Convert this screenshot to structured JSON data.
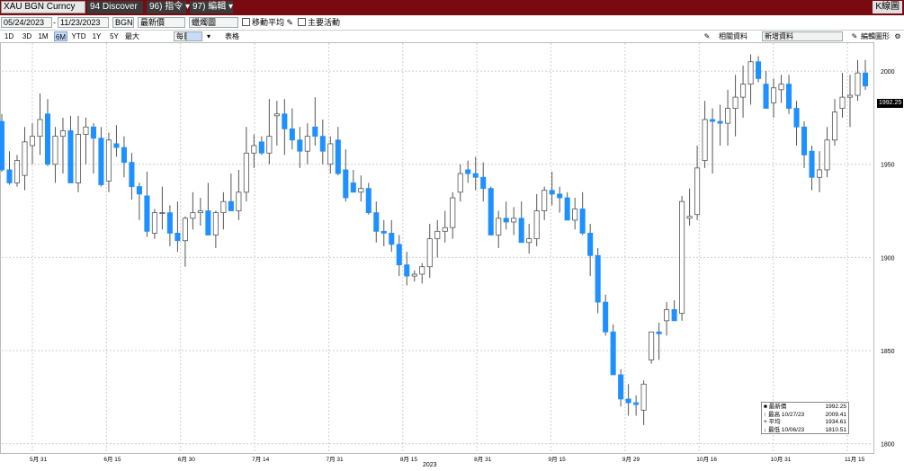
{
  "toolbar": {
    "ticker": "XAU BGN Curncy",
    "discover": "94 Discover",
    "menu_actions": "96) 指令 ▾",
    "menu_edit": "97) 編輯 ▾",
    "right_label": "K線圖"
  },
  "controls": {
    "start_date": "05/24/2023",
    "end_date": "11/23/2023",
    "source": "BGN",
    "field_last": "最新價",
    "chart_type": "蠟燭圖",
    "moving_avg": "移動平均",
    "key_events": "主要活動"
  },
  "periods": [
    "1D",
    "3D",
    "1M",
    "6M",
    "YTD",
    "1Y",
    "5Y",
    "最大"
  ],
  "selected_period": "6M",
  "frequency": "每日 ▼",
  "table_label": "表格",
  "right_controls": {
    "related": "相關資料",
    "news": "新增資料",
    "edit_chart": "編輯圖形"
  },
  "chart_data": {
    "type": "candlestick",
    "y_ticks": [
      1800,
      1850,
      1900,
      1950,
      2000
    ],
    "ylim": [
      1795,
      2015
    ],
    "x_tick_labels": [
      "5月 31",
      "6月 15",
      "6月 30",
      "7月 14",
      "7月 31",
      "8月 15",
      "8月 31",
      "9月 15",
      "9月 29",
      "10月 16",
      "10月 31",
      "11月 15"
    ],
    "year_label": "2023",
    "last_price_label": "1992.25",
    "legend": [
      {
        "key": "最新價",
        "date": "",
        "value": "1992.25"
      },
      {
        "key": "最高",
        "date": "10/27/23",
        "value": "2009.41"
      },
      {
        "key": "平均",
        "date": "",
        "value": "1934.61"
      },
      {
        "key": "最低",
        "date": "10/06/23",
        "value": "1810.51"
      }
    ],
    "colors": {
      "up": "#ffffff",
      "down": "#1e90ff",
      "wick": "#555555",
      "grid": "#cfcfcf"
    },
    "candles": [
      [
        1973,
        1977,
        1946,
        1947
      ],
      [
        1947,
        1957,
        1939,
        1940
      ],
      [
        1940,
        1955,
        1938,
        1952
      ],
      [
        1944,
        1970,
        1936,
        1962
      ],
      [
        1960,
        1972,
        1950,
        1965
      ],
      [
        1965,
        1988,
        1955,
        1974
      ],
      [
        1977,
        1985,
        1949,
        1950
      ],
      [
        1950,
        1970,
        1940,
        1965
      ],
      [
        1965,
        1975,
        1945,
        1968
      ],
      [
        1968,
        1976,
        1940,
        1940
      ],
      [
        1940,
        1976,
        1935,
        1966
      ],
      [
        1966,
        1975,
        1950,
        1970
      ],
      [
        1970,
        1972,
        1945,
        1964
      ],
      [
        1964,
        1970,
        1938,
        1939
      ],
      [
        1941,
        1967,
        1935,
        1963
      ],
      [
        1961,
        1971,
        1954,
        1959
      ],
      [
        1959,
        1965,
        1943,
        1951
      ],
      [
        1951,
        1956,
        1931,
        1938
      ],
      [
        1938,
        1940,
        1920,
        1934
      ],
      [
        1933,
        1946,
        1911,
        1914
      ],
      [
        1913,
        1926,
        1910,
        1924
      ],
      [
        1924,
        1938,
        1915,
        1924
      ],
      [
        1924,
        1928,
        1906,
        1913
      ],
      [
        1913,
        1930,
        1903,
        1909
      ],
      [
        1909,
        1922,
        1895,
        1921
      ],
      [
        1921,
        1935,
        1915,
        1924
      ],
      [
        1924,
        1932,
        1917,
        1925
      ],
      [
        1925,
        1940,
        1914,
        1912
      ],
      [
        1912,
        1925,
        1905,
        1924
      ],
      [
        1924,
        1935,
        1915,
        1930
      ],
      [
        1930,
        1945,
        1925,
        1925
      ],
      [
        1925,
        1947,
        1920,
        1935
      ],
      [
        1935,
        1970,
        1930,
        1956
      ],
      [
        1956,
        1966,
        1948,
        1960
      ],
      [
        1962,
        1965,
        1955,
        1956
      ],
      [
        1956,
        1985,
        1950,
        1965
      ],
      [
        1976,
        1984,
        1960,
        1977
      ],
      [
        1977,
        1985,
        1955,
        1969
      ],
      [
        1969,
        1980,
        1958,
        1963
      ],
      [
        1963,
        1970,
        1948,
        1957
      ],
      [
        1957,
        1972,
        1950,
        1965
      ],
      [
        1970,
        1986,
        1960,
        1965
      ],
      [
        1965,
        1974,
        1950,
        1957
      ],
      [
        1950,
        1965,
        1945,
        1961
      ],
      [
        1963,
        1970,
        1944,
        1945
      ],
      [
        1947,
        1958,
        1930,
        1932
      ],
      [
        1940,
        1947,
        1935,
        1935
      ],
      [
        1935,
        1944,
        1930,
        1937
      ],
      [
        1937,
        1940,
        1923,
        1924
      ],
      [
        1924,
        1930,
        1908,
        1914
      ],
      [
        1914,
        1920,
        1906,
        1913
      ],
      [
        1913,
        1920,
        1903,
        1907
      ],
      [
        1907,
        1912,
        1890,
        1896
      ],
      [
        1896,
        1903,
        1885,
        1890
      ],
      [
        1890,
        1893,
        1887,
        1891
      ],
      [
        1891,
        1897,
        1886,
        1895
      ],
      [
        1895,
        1918,
        1889,
        1910
      ],
      [
        1910,
        1920,
        1900,
        1914
      ],
      [
        1914,
        1925,
        1908,
        1916
      ],
      [
        1916,
        1935,
        1910,
        1932
      ],
      [
        1935,
        1950,
        1930,
        1945
      ],
      [
        1947,
        1952,
        1940,
        1945
      ],
      [
        1945,
        1954,
        1936,
        1943
      ],
      [
        1943,
        1951,
        1930,
        1937
      ],
      [
        1937,
        1938,
        1915,
        1912
      ],
      [
        1912,
        1925,
        1905,
        1921
      ],
      [
        1921,
        1930,
        1915,
        1919
      ],
      [
        1919,
        1927,
        1912,
        1921
      ],
      [
        1921,
        1930,
        1908,
        1908
      ],
      [
        1908,
        1918,
        1902,
        1910
      ],
      [
        1910,
        1934,
        1906,
        1925
      ],
      [
        1925,
        1938,
        1920,
        1936
      ],
      [
        1936,
        1946,
        1928,
        1934
      ],
      [
        1934,
        1938,
        1924,
        1932
      ],
      [
        1932,
        1935,
        1920,
        1920
      ],
      [
        1920,
        1932,
        1915,
        1926
      ],
      [
        1926,
        1935,
        1912,
        1913
      ],
      [
        1913,
        1918,
        1890,
        1901
      ],
      [
        1901,
        1905,
        1870,
        1876
      ],
      [
        1876,
        1880,
        1858,
        1860
      ],
      [
        1860,
        1864,
        1837,
        1837
      ],
      [
        1837,
        1840,
        1820,
        1824
      ],
      [
        1824,
        1832,
        1815,
        1822
      ],
      [
        1822,
        1826,
        1815,
        1821
      ],
      [
        1818,
        1834,
        1810,
        1832
      ],
      [
        1845,
        1860,
        1843,
        1860
      ],
      [
        1860,
        1865,
        1845,
        1859
      ],
      [
        1866,
        1876,
        1858,
        1872
      ],
      [
        1872,
        1877,
        1866,
        1866
      ],
      [
        1870,
        1933,
        1866,
        1930
      ],
      [
        1921,
        1937,
        1917,
        1922
      ],
      [
        1923,
        1960,
        1920,
        1948
      ],
      [
        1952,
        1984,
        1948,
        1974
      ],
      [
        1974,
        1980,
        1945,
        1973
      ],
      [
        1973,
        1982,
        1960,
        1972
      ],
      [
        1972,
        1990,
        1960,
        1980
      ],
      [
        1980,
        1998,
        1965,
        1986
      ],
      [
        1986,
        2003,
        1975,
        1993
      ],
      [
        1993,
        2009,
        1982,
        2005
      ],
      [
        2005,
        2008,
        1994,
        1996
      ],
      [
        1993,
        2000,
        1980,
        1980
      ],
      [
        1983,
        1996,
        1975,
        1991
      ],
      [
        1990,
        1998,
        1983,
        1993
      ],
      [
        1993,
        1998,
        1977,
        1980
      ],
      [
        1980,
        1984,
        1960,
        1970
      ],
      [
        1970,
        1973,
        1948,
        1955
      ],
      [
        1957,
        1960,
        1936,
        1943
      ],
      [
        1943,
        1957,
        1935,
        1947
      ],
      [
        1947,
        1970,
        1943,
        1963
      ],
      [
        1963,
        1985,
        1960,
        1978
      ],
      [
        1980,
        1999,
        1975,
        1986
      ],
      [
        1986,
        1998,
        1970,
        1987
      ],
      [
        1987,
        2006,
        1984,
        1999
      ],
      [
        1999,
        2006,
        1990,
        1992
      ]
    ]
  }
}
